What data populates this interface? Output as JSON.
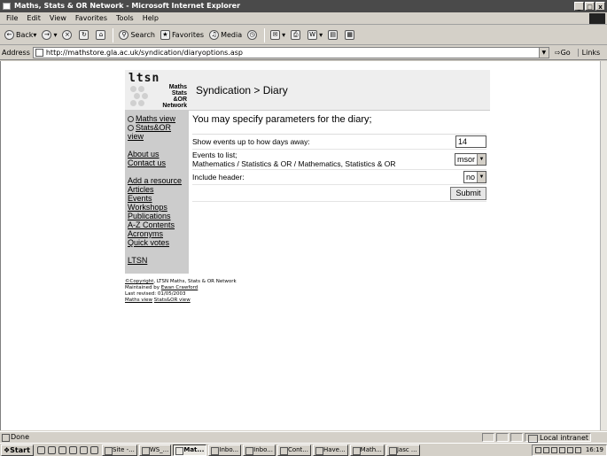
{
  "window": {
    "title": "Maths, Stats & OR Network - Microsoft Internet Explorer",
    "min": "_",
    "max": "□",
    "close": "x"
  },
  "menu": [
    "File",
    "Edit",
    "View",
    "Favorites",
    "Tools",
    "Help"
  ],
  "toolbar": {
    "back": "Back",
    "search": "Search",
    "favorites": "Favorites",
    "media": "Media"
  },
  "address": {
    "label": "Address",
    "url": "http://mathstore.gla.ac.uk/syndication/diaryoptions.asp",
    "go": "Go",
    "links": "Links"
  },
  "page": {
    "logo": {
      "ltsn": "ltsn",
      "line1": "Maths",
      "line2": "Stats",
      "line3": "&OR",
      "line4": "Network"
    },
    "title": "Syndication > Diary",
    "intro": "You may specify parameters for the diary;",
    "sidebar": {
      "maths_view": "Maths view",
      "stats_view": "Stats&OR view",
      "about": "About us",
      "contact": "Contact us",
      "add_resource": "Add a resource",
      "articles": "Articles",
      "events": "Events",
      "workshops": "Workshops",
      "publications": "Publications",
      "az": "A-Z Contents",
      "acronyms": "Acronyms",
      "quickvotes": "Quick votes",
      "ltsn": "LTSN"
    },
    "params": {
      "days_label": "Show events up to how days away:",
      "days_value": "14",
      "events_label": "Events to list;",
      "events_options": "Mathematics / Statistics & OR / Mathematics, Statistics & OR",
      "events_value": "msor",
      "header_label": "Include header:",
      "header_value": "no",
      "submit": "Submit"
    },
    "footer": {
      "copyright_link": "©Copyright",
      "copyright_text": ", LTSN Maths, Stats & OR Network",
      "maintained": "Maintained by ",
      "maintainer": "Ewan Crawford",
      "revised": "Last revised: 01/05/2003",
      "maths_view": "Maths view",
      "stats_view": "Stats&OR view"
    }
  },
  "status": {
    "text": "Done",
    "zone": "Local intranet"
  },
  "taskbar": {
    "start": "Start",
    "tasks": [
      "Site -...",
      "WS_...",
      "Mat...",
      "Inbo...",
      "Inbo...",
      "Cont...",
      "Have...",
      "Math...",
      "Jasc ..."
    ],
    "clock": "16:19"
  }
}
